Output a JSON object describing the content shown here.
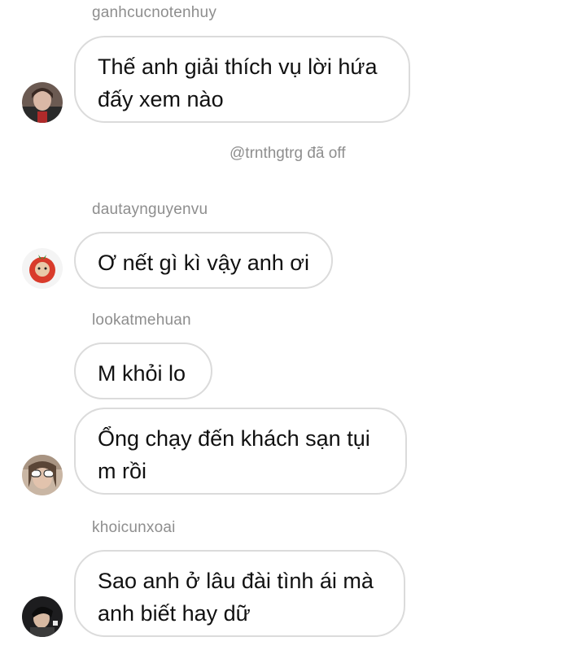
{
  "messages": [
    {
      "username": "ganhcucnotenhuy",
      "lines": [
        "Thế anh giải thích vụ lời hứa",
        "đấy xem nào"
      ]
    },
    {
      "username": "dautaynguyenvu",
      "lines": [
        "Ơ nết gì kì vậy anh ơi"
      ]
    },
    {
      "username": "lookatmehuan",
      "lines": [
        "M khỏi lo"
      ]
    },
    {
      "lines": [
        "Ổng chạy đến khách sạn tụi",
        "m rồi"
      ]
    },
    {
      "username": "khoicunxoai",
      "lines": [
        "Sao anh ở lâu đài tình ái mà",
        "anh biết hay dữ"
      ]
    }
  ],
  "system_notice": "@trnthgtrg đã off",
  "avatars": [
    "avatar-ganhcucnotenhuy",
    "avatar-dautaynguyenvu",
    "avatar-lookatmehuan",
    "avatar-khoicunxoai"
  ],
  "colors": {
    "bubble_border": "#dbdbdb",
    "username": "#8e8e8e",
    "text": "#111111",
    "background": "#ffffff"
  }
}
